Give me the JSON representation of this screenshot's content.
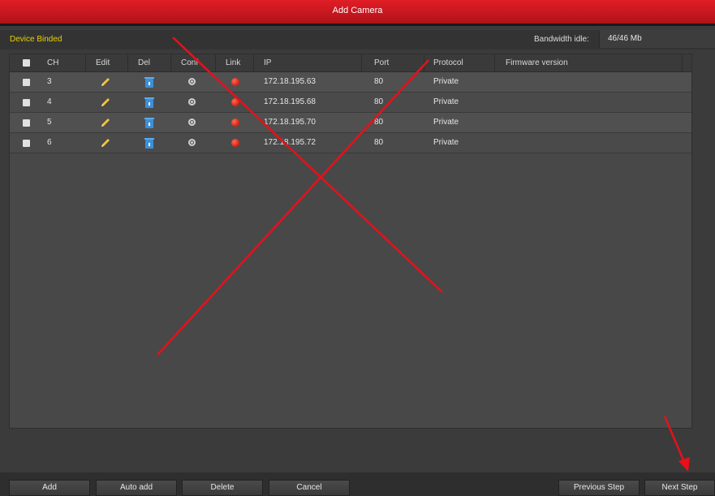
{
  "window": {
    "title": "Add Camera"
  },
  "section": {
    "title": "Device Binded",
    "bandwidth_label": "Bandwidth idle:",
    "bandwidth_value": "46/46 Mb"
  },
  "table": {
    "headers": {
      "ch": "CH",
      "edit": "Edit",
      "del": "Del",
      "conf": "Conf",
      "link": "Link",
      "ip": "IP",
      "port": "Port",
      "protocol": "Protocol",
      "firmware": "Firmware version"
    },
    "rows": [
      {
        "ch": "3",
        "ip": "172.18.195.63",
        "port": "80",
        "protocol": "Private",
        "firmware": ""
      },
      {
        "ch": "4",
        "ip": "172.18.195.68",
        "port": "80",
        "protocol": "Private",
        "firmware": ""
      },
      {
        "ch": "5",
        "ip": "172.18.195.70",
        "port": "80",
        "protocol": "Private",
        "firmware": ""
      },
      {
        "ch": "6",
        "ip": "172.18.195.72",
        "port": "80",
        "protocol": "Private",
        "firmware": ""
      }
    ]
  },
  "buttons": {
    "add": "Add",
    "auto_add": "Auto add",
    "delete": "Delete",
    "cancel": "Cancel",
    "previous": "Previous Step",
    "next": "Next Step"
  },
  "colors": {
    "title_bar": "#c8161e",
    "section_title": "#e8d200",
    "annotation": "#e8101a"
  }
}
